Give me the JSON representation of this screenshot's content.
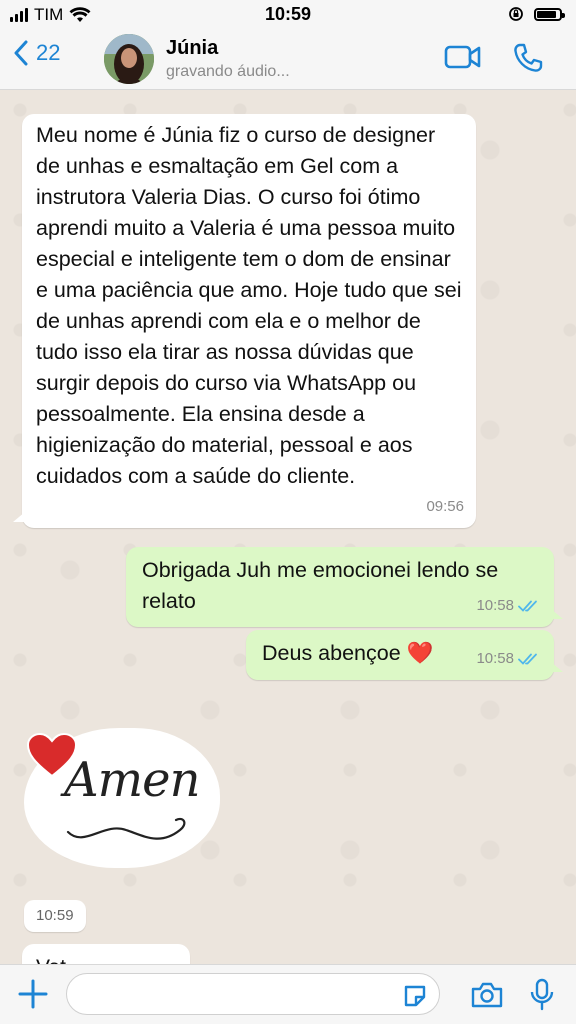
{
  "status_bar": {
    "carrier": "TIM",
    "time": "10:59"
  },
  "header": {
    "back_count": "22",
    "contact_name": "Júnia",
    "contact_status": "gravando áudio..."
  },
  "messages": [
    {
      "direction": "incoming",
      "text": "Meu nome é Júnia fiz o curso de designer de unhas e esmaltação em Gel com a instrutora Valeria Dias. O curso foi ótimo aprendi muito a Valeria é uma pessoa muito especial e inteligente tem o dom de ensinar e uma paciência que amo. Hoje tudo que sei de unhas aprendi com ela e o melhor de tudo isso ela tirar as nossa dúvidas que surgir depois do curso via WhatsApp ou pessoalmente.  Ela ensina desde a higienização do material, pessoal e aos cuidados com a saúde do cliente.",
      "time": "09:56"
    },
    {
      "direction": "outgoing",
      "text": "Obrigada Juh me emocionei lendo se relato",
      "time": "10:58"
    },
    {
      "direction": "outgoing",
      "text": "Deus abençoe ❤️",
      "time": "10:58"
    }
  ],
  "sticker": {
    "text": "Amen",
    "time": "10:59"
  },
  "partial_message": {
    "text": "Vat..."
  },
  "composer": {
    "placeholder": ""
  },
  "colors": {
    "accent": "#1d84d4",
    "incoming_bubble": "#ffffff",
    "outgoing_bubble": "#dcf8c6",
    "read_ticks": "#4fb6ec",
    "heart": "#d92b2b"
  },
  "icons": {
    "back": "chevron-left-icon",
    "video": "video-camera-icon",
    "call": "phone-icon",
    "plus": "plus-icon",
    "sticker": "sticker-icon",
    "camera": "camera-icon",
    "mic": "microphone-icon"
  }
}
